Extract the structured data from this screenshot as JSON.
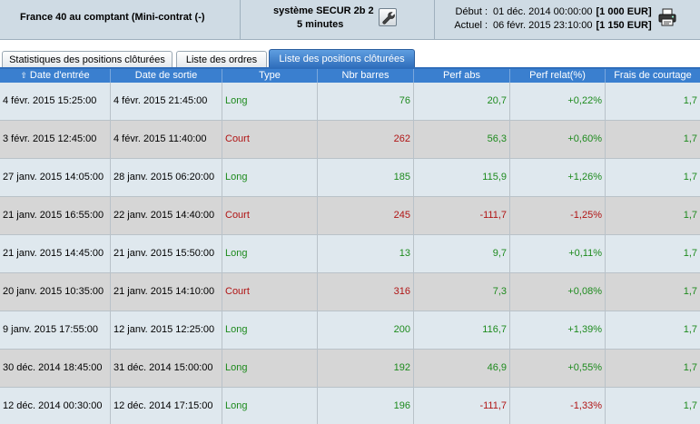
{
  "header": {
    "instrument": "France 40 au comptant (Mini-contrat  (-)",
    "system_name": "système SECUR 2b 2",
    "timeframe": "5 minutes",
    "start_label": "Début :",
    "start_value": "01 déc. 2014 00:00:00",
    "start_amount": "[1 000 EUR]",
    "current_label": "Actuel :",
    "current_value": "06 févr. 2015 23:10:00",
    "current_amount": "[1 150 EUR]",
    "settings_icon": "wrench-icon",
    "print_icon": "printer-icon"
  },
  "tabs": [
    {
      "label": "Statistiques des positions clôturées",
      "active": false
    },
    {
      "label": "Liste des ordres",
      "active": false
    },
    {
      "label": "Liste des positions clôturées",
      "active": true
    }
  ],
  "table": {
    "sort_icon": "sort-up-icon",
    "columns": [
      "Date d'entrée",
      "Date de sortie",
      "Type",
      "Nbr barres",
      "Perf abs",
      "Perf relat(%)",
      "Frais de courtage"
    ],
    "rows": [
      {
        "entry": "4 févr. 2015 15:25:00",
        "exit": "4 févr. 2015 21:45:00",
        "type": "Long",
        "bars": "76",
        "perf_abs": "20,7",
        "perf_rel": "+0,22%",
        "fees": "1,7"
      },
      {
        "entry": "3 févr. 2015 12:45:00",
        "exit": "4 févr. 2015 11:40:00",
        "type": "Court",
        "bars": "262",
        "perf_abs": "56,3",
        "perf_rel": "+0,60%",
        "fees": "1,7"
      },
      {
        "entry": "27 janv. 2015 14:05:00",
        "exit": "28 janv. 2015 06:20:00",
        "type": "Long",
        "bars": "185",
        "perf_abs": "115,9",
        "perf_rel": "+1,26%",
        "fees": "1,7"
      },
      {
        "entry": "21 janv. 2015 16:55:00",
        "exit": "22 janv. 2015 14:40:00",
        "type": "Court",
        "bars": "245",
        "perf_abs": "-111,7",
        "perf_rel": "-1,25%",
        "fees": "1,7"
      },
      {
        "entry": "21 janv. 2015 14:45:00",
        "exit": "21 janv. 2015 15:50:00",
        "type": "Long",
        "bars": "13",
        "perf_abs": "9,7",
        "perf_rel": "+0,11%",
        "fees": "1,7"
      },
      {
        "entry": "20 janv. 2015 10:35:00",
        "exit": "21 janv. 2015 14:10:00",
        "type": "Court",
        "bars": "316",
        "perf_abs": "7,3",
        "perf_rel": "+0,08%",
        "fees": "1,7"
      },
      {
        "entry": "9 janv. 2015 17:55:00",
        "exit": "12 janv. 2015 12:25:00",
        "type": "Long",
        "bars": "200",
        "perf_abs": "116,7",
        "perf_rel": "+1,39%",
        "fees": "1,7"
      },
      {
        "entry": "30 déc. 2014 18:45:00",
        "exit": "31 déc. 2014 15:00:00",
        "type": "Long",
        "bars": "192",
        "perf_abs": "46,9",
        "perf_rel": "+0,55%",
        "fees": "1,7"
      },
      {
        "entry": "12 déc. 2014 00:30:00",
        "exit": "12 déc. 2014 17:15:00",
        "type": "Long",
        "bars": "196",
        "perf_abs": "-111,7",
        "perf_rel": "-1,33%",
        "fees": "1,7"
      }
    ]
  },
  "colors": {
    "header_bg": "#cfdbe4",
    "active_tab": "#2e6dbb",
    "table_header": "#3a7fcf",
    "row_odd": "#dfe8ee",
    "row_even": "#d6d6d6",
    "long_text": "#1d8a1d",
    "short_text": "#b01414"
  }
}
